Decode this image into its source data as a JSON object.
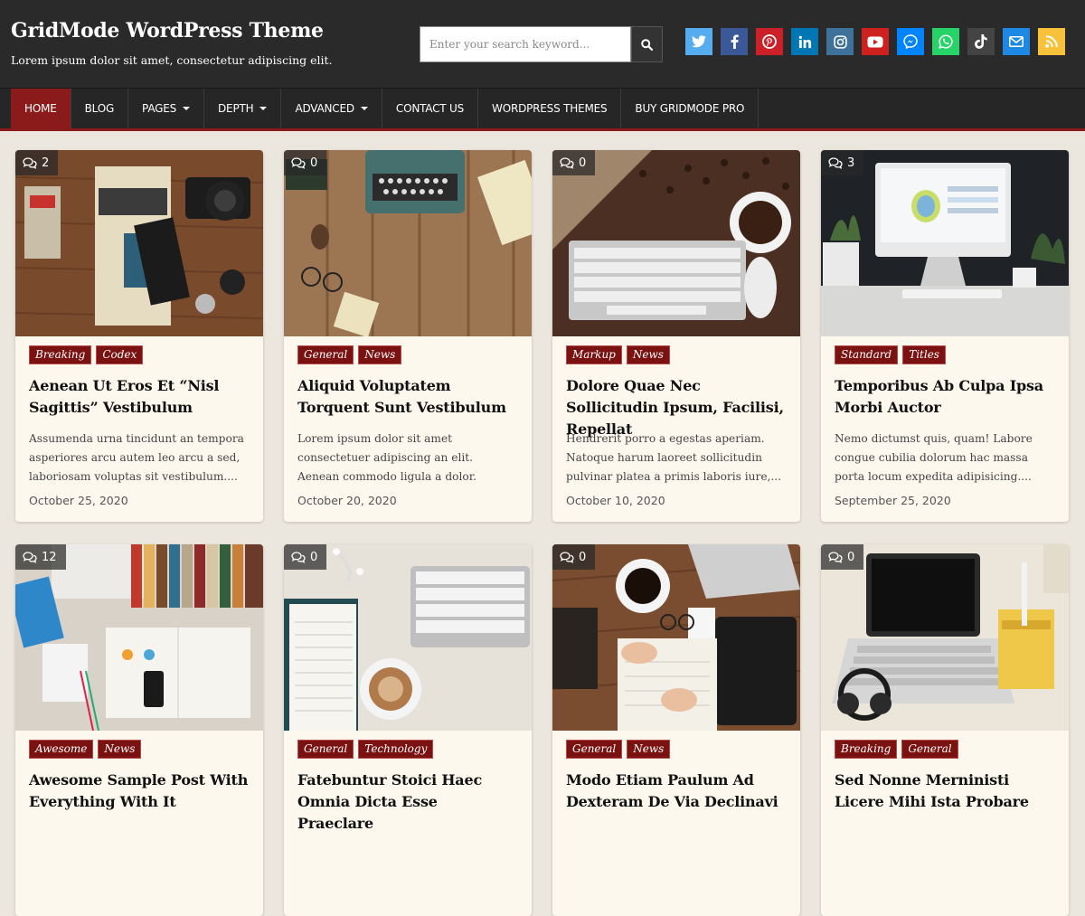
{
  "site": {
    "title": "GridMode WordPress Theme",
    "description": "Lorem ipsum dolor sit amet, consectetur adipiscing elit."
  },
  "search": {
    "placeholder": "Enter your search keyword..."
  },
  "social": [
    {
      "name": "twitter",
      "color": "#55acee"
    },
    {
      "name": "facebook",
      "color": "#3b5998"
    },
    {
      "name": "pinterest",
      "color": "#cb2027"
    },
    {
      "name": "linkedin",
      "color": "#0077b5"
    },
    {
      "name": "instagram",
      "color": "#3f729b"
    },
    {
      "name": "youtube",
      "color": "#cd201f"
    },
    {
      "name": "messenger",
      "color": "#0084ff"
    },
    {
      "name": "whatsapp",
      "color": "#25d366"
    },
    {
      "name": "tiktok",
      "color": "#444444"
    },
    {
      "name": "email",
      "color": "#1e88e5"
    },
    {
      "name": "rss",
      "color": "#f7c139"
    }
  ],
  "nav": {
    "items": [
      {
        "label": "HOME",
        "active": true,
        "dropdown": false
      },
      {
        "label": "BLOG",
        "active": false,
        "dropdown": false
      },
      {
        "label": "PAGES",
        "active": false,
        "dropdown": true
      },
      {
        "label": "DEPTH",
        "active": false,
        "dropdown": true
      },
      {
        "label": "ADVANCED",
        "active": false,
        "dropdown": true
      },
      {
        "label": "CONTACT US",
        "active": false,
        "dropdown": false
      },
      {
        "label": "WORDPRESS THEMES",
        "active": false,
        "dropdown": false
      },
      {
        "label": "BUY GRIDMODE PRO",
        "active": false,
        "dropdown": false
      }
    ]
  },
  "posts": [
    {
      "comments": "2",
      "image": "camera-book-desk",
      "tags": [
        "Breaking",
        "Codex"
      ],
      "title": "Aenean Ut Eros Et “Nisl Sagittis” Vestibulum",
      "excerpt": "Assumenda urna tincidunt an tempora asperiores arcu autem leo arcu a sed, laboriosam voluptas sit vestibulum....",
      "date": "October 25, 2020"
    },
    {
      "comments": "0",
      "image": "typewriter-wood-desk",
      "tags": [
        "General",
        "News"
      ],
      "title": "Aliquid Voluptatem Torquent Sunt Vestibulum",
      "excerpt": "Lorem ipsum dolor sit amet consectetuer adipiscing an elit. Aenean commodo ligula a dolor. Aenean massa....",
      "date": "October 20, 2020"
    },
    {
      "comments": "0",
      "image": "keyboard-coffee-desk",
      "tags": [
        "Markup",
        "News"
      ],
      "title": "Dolore Quae Nec Sollicitudin Ipsum, Facilisi, Repellat",
      "excerpt": "Hendrerit porro a egestas aperiam. Natoque harum laoreet sollicitudin pulvinar platea a primis laboris iure,...",
      "date": "October 10, 2020"
    },
    {
      "comments": "3",
      "image": "imac-workspace",
      "tags": [
        "Standard",
        "Titles"
      ],
      "title": "Temporibus Ab Culpa Ipsa Morbi Auctor",
      "excerpt": "Nemo dictumst quis, quam! Labore congue cubilia dolorum hac massa porta locum expedita adipisicing....",
      "date": "September 25, 2020"
    },
    {
      "comments": "12",
      "image": "desk-books-notepad",
      "tags": [
        "Awesome",
        "News"
      ],
      "title": "Awesome Sample Post With Everything With It",
      "excerpt": "",
      "date": ""
    },
    {
      "comments": "0",
      "image": "notebook-coffee-keyboard",
      "tags": [
        "General",
        "Technology"
      ],
      "title": "Fatebuntur Stoici Haec Omnia Dicta Esse Praeclare",
      "excerpt": "",
      "date": ""
    },
    {
      "comments": "0",
      "image": "hands-writing-desk",
      "tags": [
        "General",
        "News"
      ],
      "title": "Modo Etiam Paulum Ad Dexteram De Via Declinavi",
      "excerpt": "",
      "date": ""
    },
    {
      "comments": "0",
      "image": "laptop-headphones-desk",
      "tags": [
        "Breaking",
        "General"
      ],
      "title": "Sed Nonne Merninisti Licere Mihi Ista Probare",
      "excerpt": "",
      "date": ""
    }
  ],
  "colors": {
    "accent": "#8b1a1a",
    "tag_bg": "#7a1212",
    "header_bg": "#2a2a2a",
    "card_bg": "#fcf8ee",
    "page_bg": "#ece7de"
  }
}
